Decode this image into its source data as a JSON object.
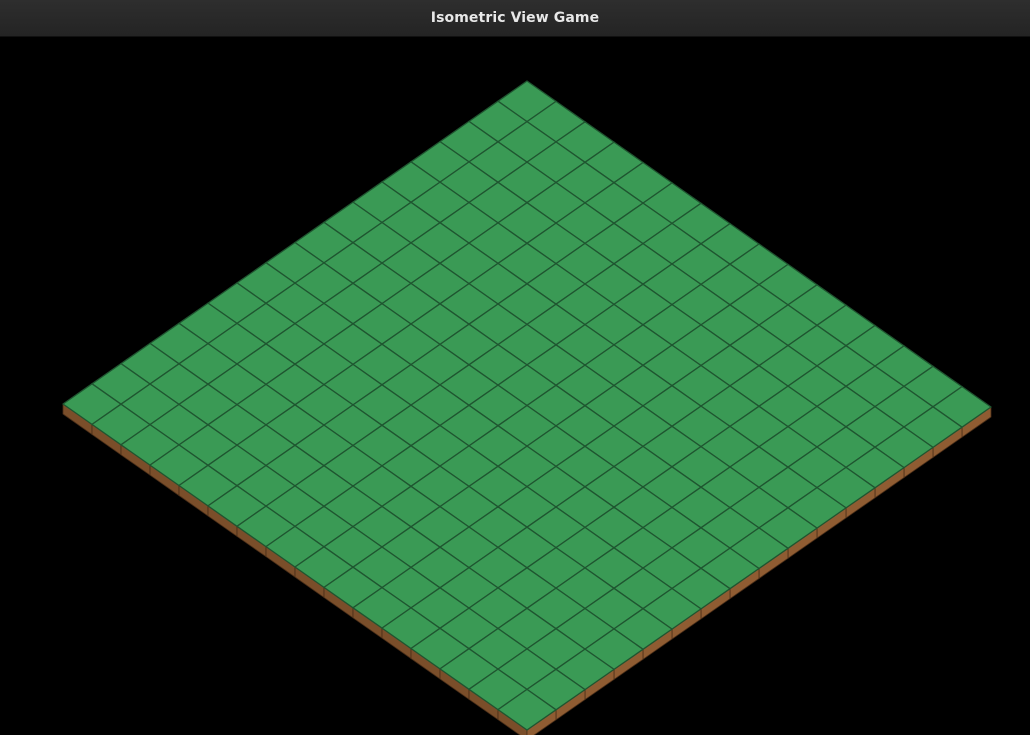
{
  "window": {
    "title": "Isometric View Game"
  },
  "game": {
    "board": {
      "rows": 16,
      "cols": 16,
      "tile_type": "grass"
    },
    "colors": {
      "background": "#000000",
      "grass_top": "#3a9a55",
      "grid_line": "#1f5530",
      "tile_edge_highlight": "#4caf64",
      "dirt_left_side": "#7a4e2a",
      "dirt_right_side": "#8f5c32",
      "dirt_line": "#4a2e18"
    }
  }
}
